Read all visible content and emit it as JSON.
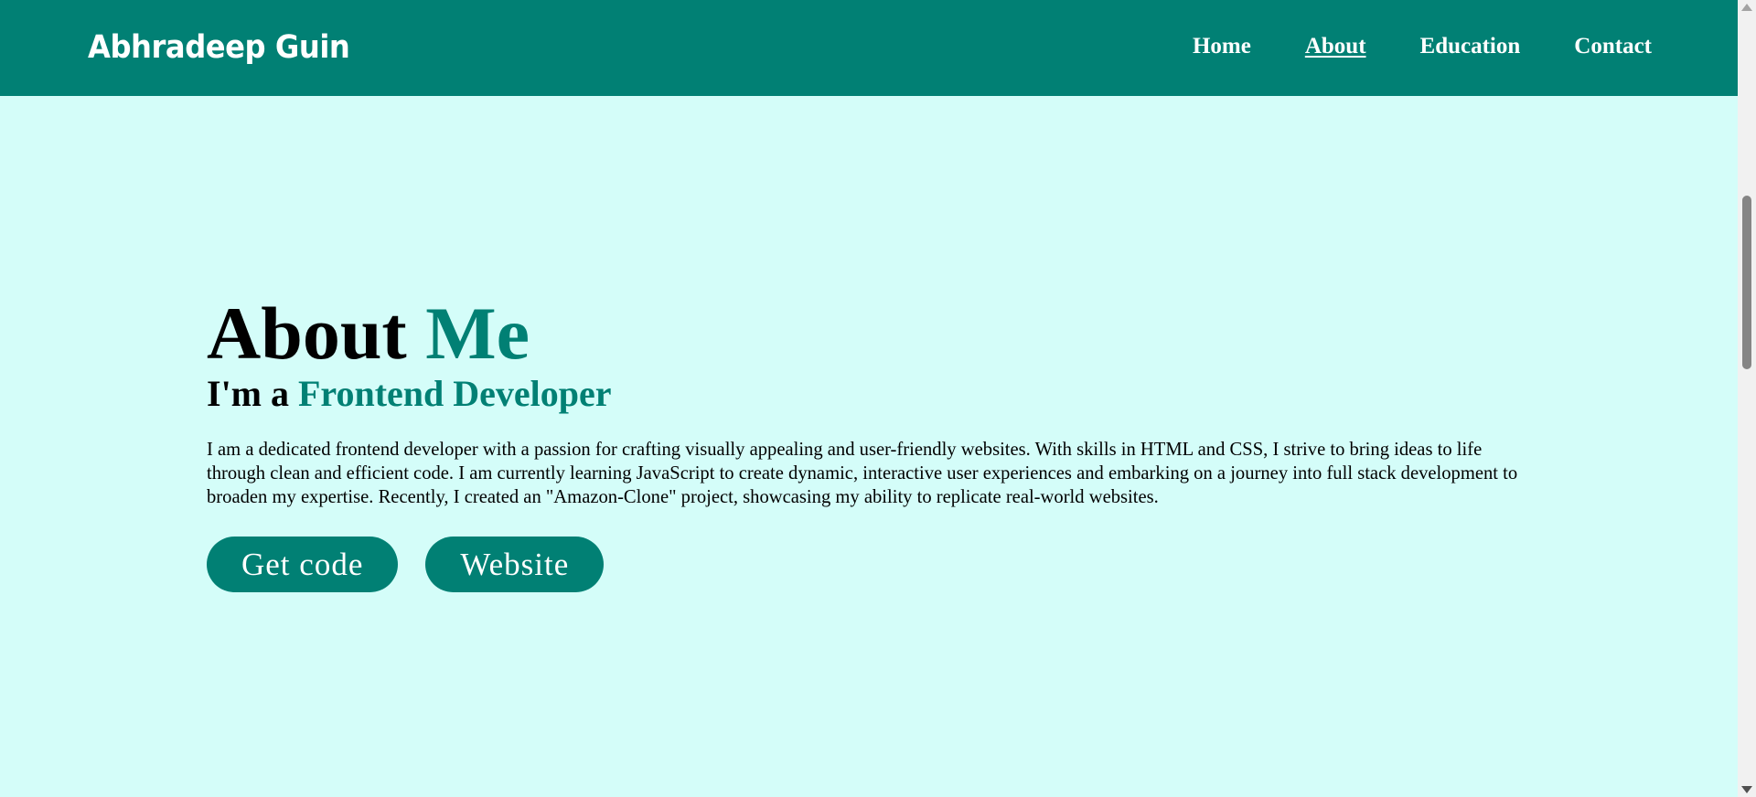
{
  "header": {
    "logo": "Abhradeep Guin",
    "nav": [
      {
        "label": "Home",
        "active": false
      },
      {
        "label": "About",
        "active": true
      },
      {
        "label": "Education",
        "active": false
      },
      {
        "label": "Contact",
        "active": false
      }
    ]
  },
  "about": {
    "title_part1": "About",
    "title_part2": "Me",
    "role_prefix": "I'm a",
    "role": "Frontend Developer",
    "bio": "I am a dedicated frontend developer with a passion for crafting visually appealing and user-friendly websites. With skills in HTML and CSS, I strive to bring ideas to life through clean and efficient code. I am currently learning JavaScript to create dynamic, interactive user experiences and embarking on a journey into full stack development to broaden my expertise. Recently, I created an \"Amazon-Clone\" project, showcasing my ability to replicate real-world websites.",
    "buttons": {
      "get_code": "Get code",
      "website": "Website"
    }
  },
  "colors": {
    "header_bg": "#018074",
    "page_bg": "#d4fdf9",
    "accent": "#018074"
  },
  "scrollbar": {
    "thumb_icon": "scrollbar-thumb",
    "up_icon": "triangle-up-icon",
    "down_icon": "triangle-down-icon"
  }
}
